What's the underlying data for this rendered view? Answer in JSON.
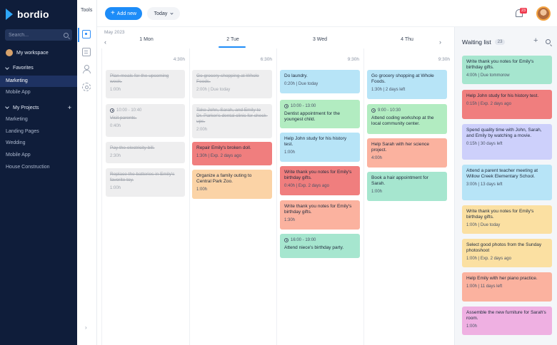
{
  "app": {
    "name": "bordio"
  },
  "sidebar": {
    "search_placeholder": "Search...",
    "workspace": "My workspace",
    "favorites_label": "Favorites",
    "favorites": [
      "Marketing",
      "Mobile App"
    ],
    "projects_label": "My Projects",
    "projects": [
      "Marketing",
      "Landing Pages",
      "Wedding",
      "Mobile App",
      "House Construction"
    ]
  },
  "tools": {
    "label": "Tools",
    "icons": [
      "calendar-icon",
      "document-icon",
      "user-icon",
      "gear-icon"
    ]
  },
  "header": {
    "add_new": "Add new",
    "today": "Today",
    "notification_count": "23"
  },
  "calendar": {
    "month": "May 2023",
    "days": [
      {
        "label": "1 Mon",
        "time": "4:30h"
      },
      {
        "label": "2 Tue",
        "time": "6:30h"
      },
      {
        "label": "3 Wed",
        "time": "9:30h"
      },
      {
        "label": "4 Thu",
        "time": "9:30h"
      }
    ],
    "mon": [
      {
        "title": "Plan meals for the upcoming week.",
        "meta": "1:00h"
      },
      {
        "clock": "10:00 - 10:40",
        "title": "Visit parents.",
        "meta": "0:40h"
      },
      {
        "title": "Pay the electricity bill.",
        "meta": "2:30h"
      },
      {
        "title": "Replace the batteries in Emily's favorite toy.",
        "meta": "1:00h"
      }
    ],
    "tue": [
      {
        "title": "Go grocery shopping at Whole Foods.",
        "meta": "2:00h | Due today"
      },
      {
        "title": "Take John, Sarah, and Emily to Dr. Parker's dental clinic for check-ups.",
        "meta": "2:00h"
      },
      {
        "title": "Repair Emily's broken doll.",
        "meta": "1:30h | Exp. 2 days ago"
      },
      {
        "title": "Organize a family outing to Central Park Zoo.",
        "meta": "1:00h"
      }
    ],
    "wed": [
      {
        "title": "Do laundry.",
        "meta": "0:20h | Due today"
      },
      {
        "clock": "10:00 - 13:00",
        "title": "Dentist appointment for the youngest child.",
        "meta": ""
      },
      {
        "title": "Help John study for his history test.",
        "meta": "1:00h"
      },
      {
        "title": "Write thank you notes for Emily's birthday gifts.",
        "meta": "0:40h | Exp. 2 days ago"
      },
      {
        "title": "Write thank you notes for Emily's birthday gifts.",
        "meta": "1:30h"
      },
      {
        "clock": "16:00 - 19:00",
        "title": "Attend niece's birthday party.",
        "meta": ""
      }
    ],
    "thu": [
      {
        "title": "Go grocery shopping at Whole Foods.",
        "meta": "1:30h | 2 days left"
      },
      {
        "clock": "9:00 - 10:30",
        "title": "Attend coding workshop at the local community center.",
        "meta": ""
      },
      {
        "title": "Help Sarah with her science project.",
        "meta": "4:00h"
      },
      {
        "title": "Book a hair appointment for Sarah.",
        "meta": "1:00h"
      }
    ]
  },
  "waiting_list": {
    "title": "Waiting list",
    "count": "23",
    "items": [
      {
        "title": "Write thank you notes for Emily's birthday gifts.",
        "meta": "4:00h | Due tommorow"
      },
      {
        "title": "Help John study for his history test.",
        "meta": "0:15h | Exp. 2 days ago"
      },
      {
        "title": "Spend quality time with John, Sarah, and Emily by watching a movie.",
        "meta": "0:15h | 30 days left"
      },
      {
        "title": "Attend a parent teacher meeting at Willow Creek Elementary School.",
        "meta": "3:00h | 13 days left"
      },
      {
        "title": "Write thank you notes for Emily's birthday gifts.",
        "meta": "1:00h | Due today"
      },
      {
        "title": "Select good photos from the Sunday photoshoot",
        "meta": "1:00h | Exp. 2 days ago"
      },
      {
        "title": "Help Emily with her piano practice.",
        "meta": "1:00h | 11 days left"
      },
      {
        "title": "Assemble the new furniture for Sarah's room.",
        "meta": "1:00h"
      }
    ]
  }
}
